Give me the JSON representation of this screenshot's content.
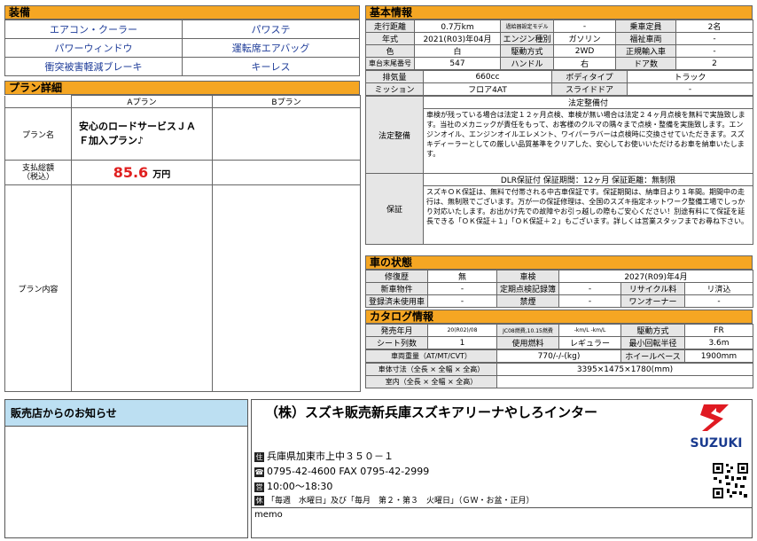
{
  "equipment": {
    "header": "装備",
    "items": [
      "エアコン・クーラー",
      "パワステ",
      "パワーウィンドウ",
      "運転席エアバッグ",
      "衝突被害軽減ブレーキ",
      "キーレス"
    ]
  },
  "plan": {
    "header": "プラン詳細",
    "col_a": "Aプラン",
    "col_b": "Bプラン",
    "row_name_label": "プラン名",
    "plan_a_name": "安心のロードサービスＪＡＦ加入プラン♪",
    "row_price_label": "支払総額\n（税込）",
    "price_value": "85.6",
    "price_unit": "万円",
    "row_content_label": "プラン内容"
  },
  "basic": {
    "header": "基本情報",
    "rows": [
      [
        "走行距離",
        "0.7万km",
        "過給器設定モデル",
        "-",
        "乗車定員",
        "2名"
      ],
      [
        "年式",
        "2021(R03)年04月",
        "エンジン種別",
        "ガソリン",
        "福祉車両",
        "-"
      ],
      [
        "色",
        "白",
        "駆動方式",
        "2WD",
        "正規輸入車",
        "-"
      ],
      [
        "車台末尾番号",
        "547",
        "ハンドル",
        "右",
        "ドア数",
        "2"
      ]
    ],
    "rows2": [
      [
        "排気量",
        "660cc",
        "ボディタイプ",
        "トラック"
      ],
      [
        "ミッション",
        "フロア4AT",
        "スライドドア",
        "-"
      ]
    ],
    "legal_label": "法定整備",
    "legal_title": "法定整備付",
    "legal_text": "車検が残っている場合は法定１２ヶ月点検、車検が無い場合は法定２４ヶ月点検を無料で実施致します。当社のメカニックが責任をもって、お客様のクルマの隅々まで点検・整備を実施致します。エンジンオイル、エンジンオイルエレメント、ワイパーラバーは点検時に交換させていただきます。スズキディーラーとしての厳しい品質基準をクリアした、安心してお使いいただけるお車を納車いたします。",
    "warranty_label": "保証",
    "warranty_title": "DLR保証付 保証期間：12ヶ月 保証距離：無制限",
    "warranty_text": "スズキＯＫ保証は、無料で付帯される中古車保証です。保証期間は、納車日より１年間。期間中の走行は、無制限でございます。万が一の保証修理は、全国のスズキ指定ネットワーク整備工場でしっかり対応いたします。お出かけ先での故障やお引っ越しの際もご安心ください！別途有料にて保証を延長できる「ＯＫ保証＋１」「ＯＫ保証＋２」もございます。詳しくは営業スタッフまでお尋ね下さい。"
  },
  "condition": {
    "header": "車の状態",
    "rows": [
      [
        "修復歴",
        "無",
        "車検",
        "2027(R09)年4月"
      ],
      [
        "新車物件",
        "-",
        "定期点検記録簿",
        "-",
        "リサイクル料",
        "リ済込"
      ],
      [
        "登録済未使用車",
        "-",
        "禁煙",
        "-",
        "ワンオーナー",
        "-"
      ]
    ]
  },
  "catalog": {
    "header": "カタログ情報",
    "row1": [
      "発売年月",
      "20(R02)/08",
      "JC08燃費,10.15燃費",
      "-km/L -km/L",
      "駆動方式",
      "FR"
    ],
    "row2": [
      "シート列数",
      "1",
      "使用燃料",
      "レギュラー",
      "最小回転半径",
      "3.6m"
    ],
    "row3": [
      "車両重量（AT/MT/CVT）",
      "770/-/-(kg)",
      "ホイールベース",
      "1900mm"
    ],
    "row4": [
      "車体寸法（全長 × 全幅 × 全高）",
      "3395×1475×1780(mm)"
    ],
    "row5": [
      "室内（全長 × 全幅 × 全高）",
      ""
    ]
  },
  "notice": {
    "header": "販売店からのお知らせ"
  },
  "dealer": {
    "name": "（株）スズキ販売新兵庫スズキアリーナやしろインター",
    "logo_text": "SUZUKI",
    "address_icon": "住",
    "address": "兵庫県加東市上中３５０－１",
    "phone_icon": "☎",
    "phone": "0795-42-4600  FAX 0795-42-2999",
    "hours_icon": "営",
    "hours": "10:00～18:30",
    "holiday_icon": "休",
    "holiday": "「毎週　水曜日」及び「毎月　第２・第３　火曜日」（ＧＷ・お盆・正月）",
    "memo_label": "memo"
  }
}
